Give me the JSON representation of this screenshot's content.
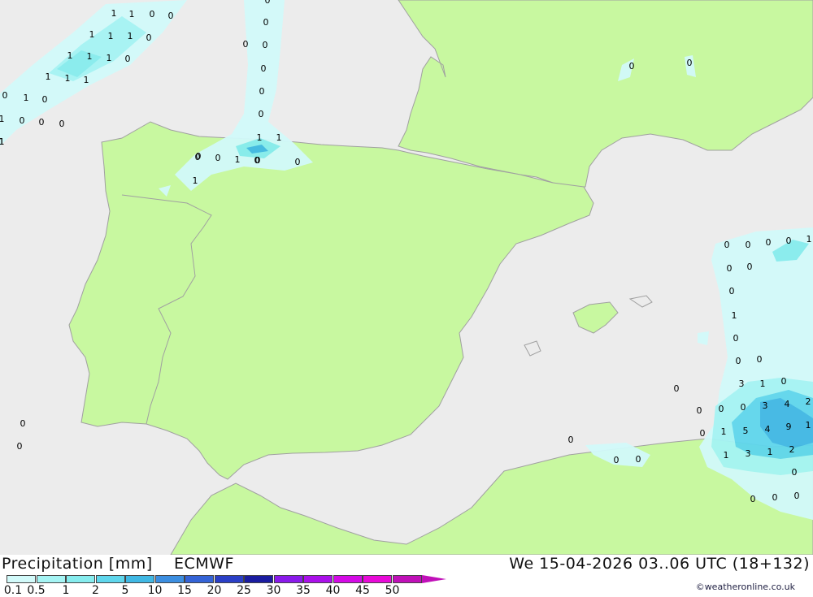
{
  "footer": {
    "title": "Precipitation [mm]",
    "model": "ECMWF",
    "valid_time": "We 15-04-2026 03..06 UTC (18+132)",
    "credit": "©weatheronline.co.uk"
  },
  "legend": {
    "labels": [
      "0.1",
      "0.5",
      "1",
      "2",
      "5",
      "10",
      "15",
      "20",
      "25",
      "30",
      "35",
      "40",
      "45",
      "50"
    ],
    "colors": [
      "#d2fafa",
      "#a5f4f4",
      "#86ecee",
      "#5fd6ec",
      "#40b8e4",
      "#3c8ee0",
      "#3463d6",
      "#2a3fc6",
      "#1a1ca0",
      "#8a1aea",
      "#aa10ea",
      "#d40ae6",
      "#e80ad8",
      "#c010b8"
    ]
  },
  "map": {
    "colors": {
      "sea": "#ececec",
      "land": "#c8f8a0",
      "border": "#a0a0a0"
    },
    "values": [
      "1",
      "1",
      "0",
      "0",
      "1",
      "1",
      "1",
      "0",
      "1",
      "1",
      "1",
      "0",
      "1",
      "1",
      "1",
      "1",
      "0",
      "0",
      "1",
      "1",
      "0",
      "1",
      "0",
      "0",
      "0",
      "0",
      "0",
      "0",
      "0",
      "0",
      "0",
      "0",
      "0",
      "0",
      "1",
      "1",
      "0",
      "0",
      "1",
      "0",
      "0",
      "1",
      "0",
      "0",
      "0",
      "0",
      "0",
      "1",
      "0",
      "0",
      "1",
      "0",
      "0",
      "0",
      "0",
      "0",
      "0",
      "0",
      "3",
      "1",
      "0",
      "0",
      "0",
      "3",
      "4",
      "2",
      "0",
      "1",
      "5",
      "4",
      "9",
      "1",
      "1",
      "3",
      "1",
      "2",
      "0",
      "0",
      "0",
      "0",
      "0",
      "0",
      "0",
      "0"
    ]
  }
}
